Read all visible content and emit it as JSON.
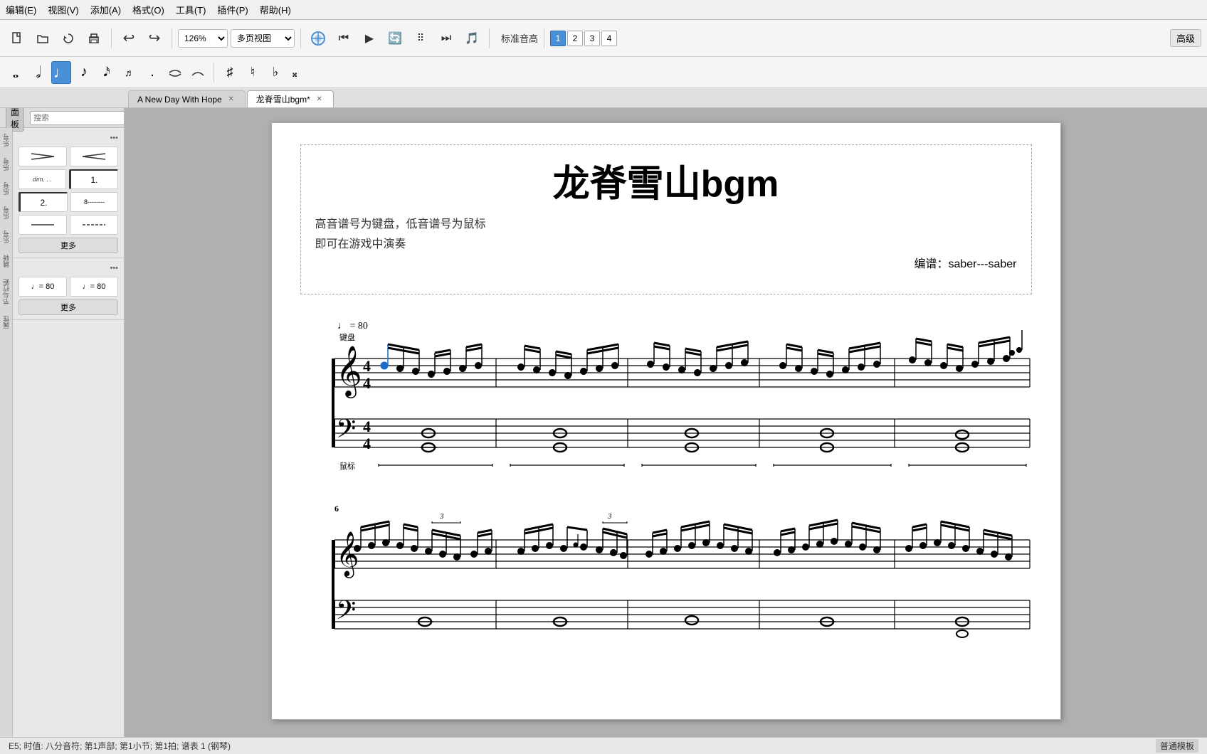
{
  "menubar": {
    "items": [
      "编辑(E)",
      "视图(V)",
      "添加(A)",
      "格式(O)",
      "工具(T)",
      "插件(P)",
      "帮助(H)"
    ]
  },
  "toolbar": {
    "zoom": "126%",
    "view_mode": "多页视图",
    "standard_pitch": "标准音高",
    "advanced": "高级",
    "num_buttons": [
      "1",
      "2",
      "3",
      "4"
    ]
  },
  "tabs": [
    {
      "label": "A New Day With Hope",
      "active": false,
      "closable": true
    },
    {
      "label": "龙脊雪山bgm*",
      "active": true,
      "closable": true
    }
  ],
  "left_panel": {
    "tab_label": "面板",
    "search_placeholder": "搜索",
    "sections": [
      {
        "label": "",
        "items": [
          "渐强",
          "渐弱",
          "dim...",
          "1.",
          "2.",
          "8-------"
        ]
      },
      {
        "label": "",
        "tempo_items": [
          "♩= 80",
          "♩= 80"
        ],
        "more": "更多"
      }
    ],
    "side_labels": [
      "乐号",
      "乐号",
      "乐号",
      "乐号",
      "乐号",
      "跳转",
      "节与行距",
      "属性"
    ]
  },
  "score": {
    "title": "龙脊雪山bgm",
    "subtitle1": "高音谱号为键盘，低音谱号为鼠标",
    "subtitle2": "即可在游戏中演奏",
    "arranger": "编谱：saber---saber",
    "tempo": "♩ = 80",
    "keyboard_label": "键盘",
    "mouse_label": "鼠标",
    "time_sig": "4/4",
    "measure_6": "6"
  },
  "status_bar": {
    "info": "E5; 时值: 八分音符; 第1声部; 第1小节; 第1拍; 谱表 1 (钢琴)",
    "mode": "普通模板"
  }
}
